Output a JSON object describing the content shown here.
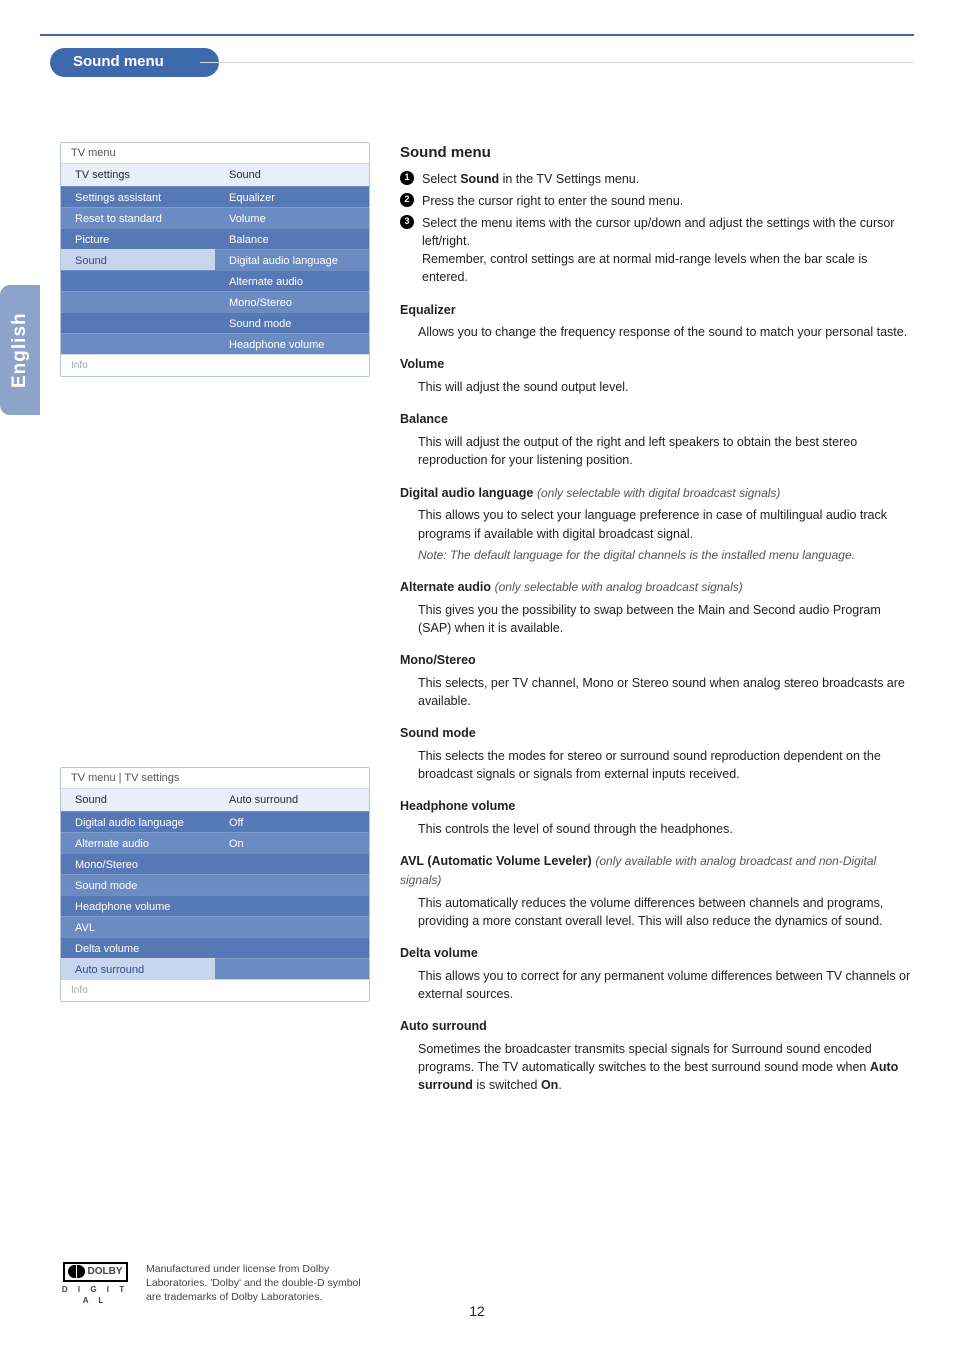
{
  "header": {
    "breadcrumb": "Sound menu",
    "language_tab": "English"
  },
  "menu1": {
    "title": "TV menu",
    "left_header": "TV settings",
    "right_header": "Sound",
    "left_items": [
      "Settings assistant",
      "Reset to standard",
      "Picture",
      "Sound"
    ],
    "left_selected_index": 3,
    "right_items": [
      "Equalizer",
      "Volume",
      "Balance",
      "Digital audio language",
      "Alternate audio",
      "Mono/Stereo",
      "Sound mode",
      "Headphone volume"
    ],
    "info": "Info"
  },
  "menu2": {
    "title": "TV menu | TV settings",
    "left_header": "Sound",
    "right_header": "Auto surround",
    "left_items": [
      "Digital audio language",
      "Alternate audio",
      "Mono/Stereo",
      "Sound mode",
      "Headphone volume",
      "AVL",
      "Delta volume",
      "Auto surround"
    ],
    "left_selected_index": 7,
    "right_items": [
      "Off",
      "On"
    ],
    "info": "Info"
  },
  "content": {
    "heading": "Sound menu",
    "steps": [
      {
        "n": "1",
        "text_pre": "Select ",
        "bold": "Sound",
        "text_post": " in the TV Settings menu."
      },
      {
        "n": "2",
        "text_pre": "Press the cursor right to enter the sound menu.",
        "bold": "",
        "text_post": ""
      },
      {
        "n": "3",
        "text_pre": "Select the menu items with the cursor up/down and adjust the settings with the cursor left/right.",
        "bold": "",
        "text_post": "",
        "extra": "Remember, control settings are at normal mid-range levels when the bar scale is entered."
      }
    ],
    "sections": [
      {
        "title": "Equalizer",
        "qual": "",
        "body": "Allows you to change the frequency response of the sound to match your personal taste.",
        "note": ""
      },
      {
        "title": "Volume",
        "qual": "",
        "body": "This will adjust the sound output level.",
        "note": ""
      },
      {
        "title": "Balance",
        "qual": "",
        "body": "This will adjust the output of the right and left speakers to obtain the best stereo reproduction for your listening position.",
        "note": ""
      },
      {
        "title": "Digital audio language",
        "qual": "(only selectable with digital broadcast signals)",
        "body": "This allows you to select your language preference in case of multilingual audio track programs if available with digital broadcast signal.",
        "note": "Note: The default language for the digital channels is the installed menu language."
      },
      {
        "title": "Alternate audio",
        "qual": "(only selectable with analog broadcast signals)",
        "body": "This gives you the possibility to swap between the Main and Second audio Program (SAP) when it is available.",
        "note": ""
      },
      {
        "title": "Mono/Stereo",
        "qual": "",
        "body": "This selects, per TV channel, Mono or Stereo sound when analog stereo broadcasts are available.",
        "note": ""
      },
      {
        "title": "Sound mode",
        "qual": "",
        "body": "This selects the modes for stereo or surround sound reproduction dependent on the broadcast signals or signals from external inputs received.",
        "note": ""
      },
      {
        "title": "Headphone volume",
        "qual": "",
        "body": "This controls the level of sound through the headphones.",
        "note": ""
      },
      {
        "title": "AVL (Automatic Volume Leveler)",
        "qual": "(only available with analog broadcast and non-Digital signals)",
        "body": "This automatically reduces the volume differences between channels and programs, providing a more constant overall level. This will also reduce the dynamics of sound.",
        "note": ""
      },
      {
        "title": "Delta volume",
        "qual": "",
        "body": "This allows you to correct for any permanent volume differences between TV channels or external sources.",
        "note": ""
      },
      {
        "title": "Auto surround",
        "qual": "",
        "body_pre": "Sometimes the broadcaster transmits special signals for Surround sound encoded programs. The TV automatically switches to the best surround sound mode when ",
        "bold1": "Auto surround",
        "mid": " is switched ",
        "bold2": "On",
        "post": ".",
        "note": ""
      }
    ]
  },
  "dolby": {
    "logo_text": "DOLBY",
    "logo_sub": "D I G I T A L",
    "notice": "Manufactured under license from Dolby Laboratories. 'Dolby' and the double-D symbol are trademarks of Dolby Laboratories."
  },
  "page_number": "12"
}
